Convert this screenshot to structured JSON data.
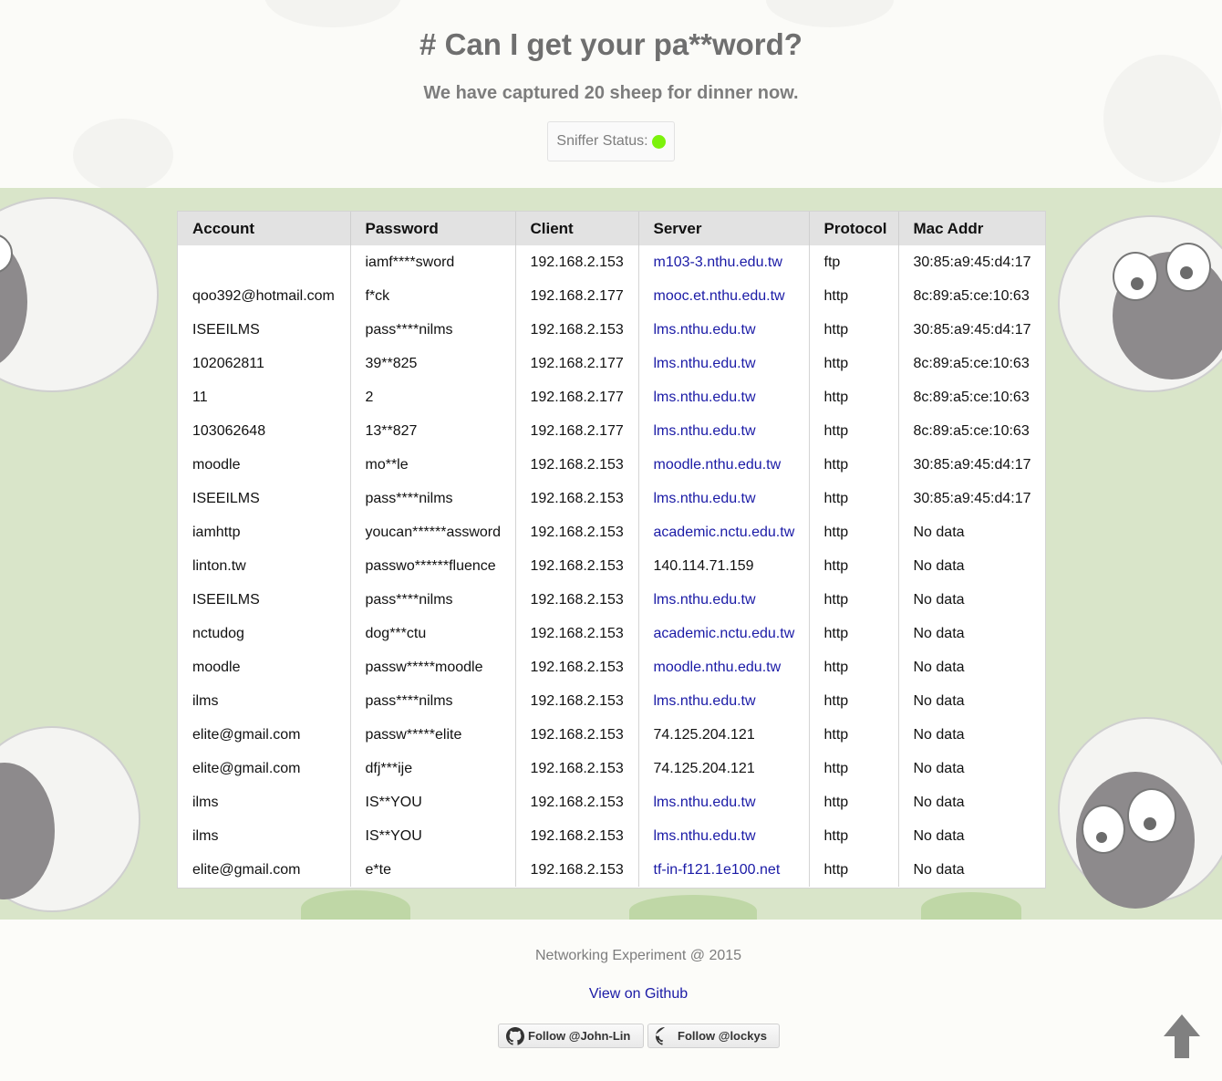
{
  "header": {
    "title": "# Can I get your pa**word?",
    "subtitle": "We have captured 20 sheep for dinner now.",
    "status_label": "Sniffer Status:",
    "status_color": "#7cf20c"
  },
  "table": {
    "columns": [
      "Account",
      "Password",
      "Client",
      "Server",
      "Protocol",
      "Mac Addr"
    ],
    "rows": [
      {
        "account": "",
        "password": "iamf****sword",
        "client": "192.168.2.153",
        "server": "m103-3.nthu.edu.tw",
        "server_link": true,
        "protocol": "ftp",
        "mac": "30:85:a9:45:d4:17"
      },
      {
        "account": "qoo392@hotmail.com",
        "password": "f*ck",
        "client": "192.168.2.177",
        "server": "mooc.et.nthu.edu.tw",
        "server_link": true,
        "protocol": "http",
        "mac": "8c:89:a5:ce:10:63"
      },
      {
        "account": "ISEEILMS",
        "password": "pass****nilms",
        "client": "192.168.2.153",
        "server": "lms.nthu.edu.tw",
        "server_link": true,
        "protocol": "http",
        "mac": "30:85:a9:45:d4:17"
      },
      {
        "account": "102062811",
        "password": "39**825",
        "client": "192.168.2.177",
        "server": "lms.nthu.edu.tw",
        "server_link": true,
        "protocol": "http",
        "mac": "8c:89:a5:ce:10:63"
      },
      {
        "account": "11",
        "password": "2",
        "client": "192.168.2.177",
        "server": "lms.nthu.edu.tw",
        "server_link": true,
        "protocol": "http",
        "mac": "8c:89:a5:ce:10:63"
      },
      {
        "account": "103062648",
        "password": "13**827",
        "client": "192.168.2.177",
        "server": "lms.nthu.edu.tw",
        "server_link": true,
        "protocol": "http",
        "mac": "8c:89:a5:ce:10:63"
      },
      {
        "account": "moodle",
        "password": "mo**le",
        "client": "192.168.2.153",
        "server": "moodle.nthu.edu.tw",
        "server_link": true,
        "protocol": "http",
        "mac": "30:85:a9:45:d4:17"
      },
      {
        "account": "ISEEILMS",
        "password": "pass****nilms",
        "client": "192.168.2.153",
        "server": "lms.nthu.edu.tw",
        "server_link": true,
        "protocol": "http",
        "mac": "30:85:a9:45:d4:17"
      },
      {
        "account": "iamhttp",
        "password": "youcan******assword",
        "client": "192.168.2.153",
        "server": "academic.nctu.edu.tw",
        "server_link": true,
        "protocol": "http",
        "mac": "No data"
      },
      {
        "account": "linton.tw",
        "password": "passwo******fluence",
        "client": "192.168.2.153",
        "server": "140.114.71.159",
        "server_link": false,
        "protocol": "http",
        "mac": "No data"
      },
      {
        "account": "ISEEILMS",
        "password": "pass****nilms",
        "client": "192.168.2.153",
        "server": "lms.nthu.edu.tw",
        "server_link": true,
        "protocol": "http",
        "mac": "No data"
      },
      {
        "account": "nctudog",
        "password": "dog***ctu",
        "client": "192.168.2.153",
        "server": "academic.nctu.edu.tw",
        "server_link": true,
        "protocol": "http",
        "mac": "No data"
      },
      {
        "account": "moodle",
        "password": "passw*****moodle",
        "client": "192.168.2.153",
        "server": "moodle.nthu.edu.tw",
        "server_link": true,
        "protocol": "http",
        "mac": "No data"
      },
      {
        "account": "ilms",
        "password": "pass****nilms",
        "client": "192.168.2.153",
        "server": "lms.nthu.edu.tw",
        "server_link": true,
        "protocol": "http",
        "mac": "No data"
      },
      {
        "account": "elite@gmail.com",
        "password": "passw*****elite",
        "client": "192.168.2.153",
        "server": "74.125.204.121",
        "server_link": false,
        "protocol": "http",
        "mac": "No data"
      },
      {
        "account": "elite@gmail.com",
        "password": "dfj***ije",
        "client": "192.168.2.153",
        "server": "74.125.204.121",
        "server_link": false,
        "protocol": "http",
        "mac": "No data"
      },
      {
        "account": "ilms",
        "password": "IS**YOU",
        "client": "192.168.2.153",
        "server": "lms.nthu.edu.tw",
        "server_link": true,
        "protocol": "http",
        "mac": "No data"
      },
      {
        "account": "ilms",
        "password": "IS**YOU",
        "client": "192.168.2.153",
        "server": "lms.nthu.edu.tw",
        "server_link": true,
        "protocol": "http",
        "mac": "No data"
      },
      {
        "account": "elite@gmail.com",
        "password": "e*te",
        "client": "192.168.2.153",
        "server": "tf-in-f121.1e100.net",
        "server_link": true,
        "protocol": "http",
        "mac": "No data"
      }
    ]
  },
  "footer": {
    "note": "Networking Experiment @ 2015",
    "github_link": "View on Github",
    "follow_buttons": [
      "Follow @John-Lin",
      "Follow @lockys"
    ]
  },
  "icons": {
    "github": "github-icon",
    "scroll_top": "up-arrow-icon"
  }
}
